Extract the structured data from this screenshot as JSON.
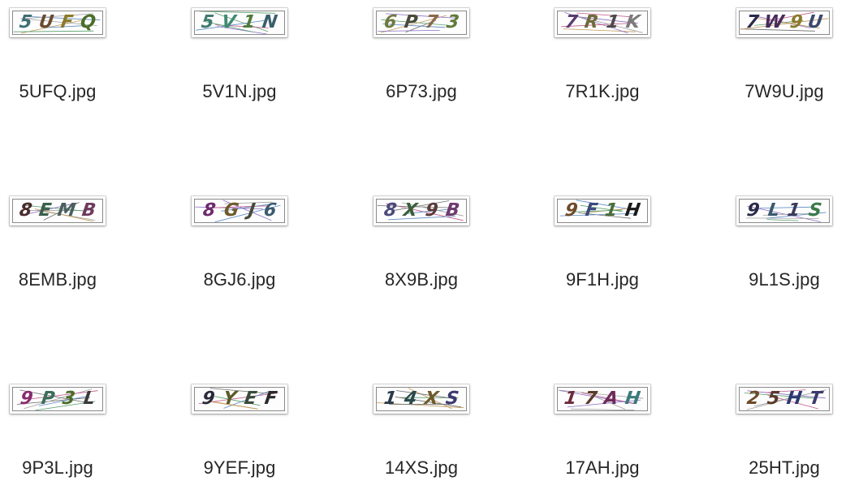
{
  "files": [
    {
      "name": "5UFQ.jpg",
      "code": "5UFQ",
      "colors": [
        "#3f6e73",
        "#6b4a2e",
        "#8a7a2a",
        "#4b6e2a"
      ]
    },
    {
      "name": "5V1N.jpg",
      "code": "5V1N",
      "colors": [
        "#3f7a6e",
        "#3f8a73",
        "#4f7a3a",
        "#3a5f6e"
      ]
    },
    {
      "name": "6P73.jpg",
      "code": "6P73",
      "colors": [
        "#6e7a3f",
        "#4a4a3a",
        "#8a6a4a",
        "#5f7a3a"
      ]
    },
    {
      "name": "7R1K.jpg",
      "code": "7R1K",
      "colors": [
        "#5a3a6e",
        "#6e6a3a",
        "#4a4a4a",
        "#7a7a7a"
      ]
    },
    {
      "name": "7W9U.jpg",
      "code": "7W9U",
      "colors": [
        "#2a2a4a",
        "#4a2a5a",
        "#8a7a2a",
        "#3a4a6e"
      ]
    },
    {
      "name": "8EMB.jpg",
      "code": "8EMB",
      "colors": [
        "#4a2a2a",
        "#3a5f4a",
        "#4a5f5f",
        "#6e3a5f"
      ]
    },
    {
      "name": "8GJ6.jpg",
      "code": "8GJ6",
      "colors": [
        "#6e2a6e",
        "#6e5a2a",
        "#4a4a3a",
        "#3a5a6e"
      ]
    },
    {
      "name": "8X9B.jpg",
      "code": "8X9B",
      "colors": [
        "#4a4a7a",
        "#3a5f3a",
        "#5a3a3a",
        "#6e3a6e"
      ]
    },
    {
      "name": "9F1H.jpg",
      "code": "9F1H",
      "colors": [
        "#6e4a2a",
        "#3a4a7a",
        "#4a6e3a",
        "#1a1a1a"
      ]
    },
    {
      "name": "9L1S.jpg",
      "code": "9L1S",
      "colors": [
        "#2a2a4a",
        "#3a5a6e",
        "#3a3a5a",
        "#3a7a4a"
      ]
    },
    {
      "name": "9P3L.jpg",
      "code": "9P3L",
      "colors": [
        "#8a2a6e",
        "#3a6e5a",
        "#4a6e2a",
        "#3a3a3a"
      ]
    },
    {
      "name": "9YEF.jpg",
      "code": "9YEF",
      "colors": [
        "#2a2a3a",
        "#5a5a2a",
        "#3a4a3a",
        "#2a2a2a"
      ]
    },
    {
      "name": "14XS.jpg",
      "code": "14XS",
      "colors": [
        "#2a3a4a",
        "#2a4a4a",
        "#6e5a2a",
        "#3a3a6e"
      ]
    },
    {
      "name": "17AH.jpg",
      "code": "17AH",
      "colors": [
        "#6e2a3a",
        "#5a3a2a",
        "#6e2a5a",
        "#3a7a7a"
      ]
    },
    {
      "name": "25HT.jpg",
      "code": "25HT",
      "colors": [
        "#6e4a2a",
        "#5a3a2a",
        "#2a3a6e",
        "#3a3a6e"
      ]
    }
  ]
}
